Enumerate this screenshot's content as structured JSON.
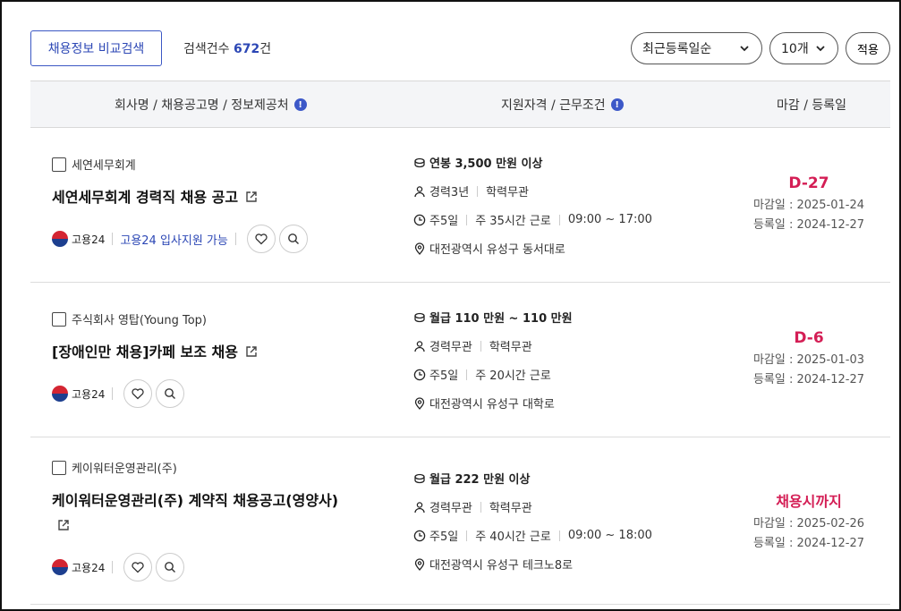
{
  "toolbar": {
    "compare_label": "채용정보 비교검색",
    "count_prefix": "검색건수 ",
    "count_value": "672",
    "count_suffix": "건",
    "sort_selected": "최근등록일순",
    "per_page_selected": "10개",
    "apply_label": "적용"
  },
  "header": {
    "col1": "회사명 / 채용공고명 / 정보제공처",
    "col2": "지원자격 / 근무조건",
    "col3": "마감 / 등록일",
    "info_glyph": "!"
  },
  "jobs": [
    {
      "company": "세연세무회계",
      "title": "세연세무회계 경력직 채용 공고",
      "source": "고용24",
      "apply_note": "고용24 입사지원 가능",
      "salary": "연봉 3,500 만원 이상",
      "career": "경력3년",
      "education": "학력무관",
      "days": "주5일",
      "hours": "주 35시간 근로",
      "time": "09:00 ~ 17:00",
      "location": "대전광역시 유성구 동서대로",
      "dday": "D-27",
      "deadline": "마감일 : 2025-01-24",
      "registered": "등록일 : 2024-12-27"
    },
    {
      "company": "주식회사 영탑(Young Top)",
      "title": "[장애인만 채용]카페 보조 채용",
      "source": "고용24",
      "salary": "월급 110 만원 ~ 110 만원",
      "career": "경력무관",
      "education": "학력무관",
      "days": "주5일",
      "hours": "주 20시간 근로",
      "location": "대전광역시 유성구 대학로",
      "dday": "D-6",
      "deadline": "마감일 : 2025-01-03",
      "registered": "등록일 : 2024-12-27"
    },
    {
      "company": "케이워터운영관리(주)",
      "title": "케이워터운영관리(주) 계약직 채용공고(영양사)",
      "source": "고용24",
      "salary": "월급 222 만원 이상",
      "career": "경력무관",
      "education": "학력무관",
      "days": "주5일",
      "hours": "주 40시간 근로",
      "time": "09:00 ~ 18:00",
      "location": "대전광역시 유성구 테크노8로",
      "dday": "채용시까지",
      "deadline": "마감일 : 2025-02-26",
      "registered": "등록일 : 2024-12-27"
    }
  ],
  "colors": {
    "accent": "#2c47b5",
    "dday": "#d41e55",
    "header_bg": "#f4f5f7"
  },
  "icons": [
    "external-link-icon",
    "heart-icon",
    "search-icon",
    "coin-icon",
    "person-icon",
    "clock-icon",
    "location-pin-icon",
    "chevron-down-icon",
    "info-icon",
    "goyong24-logo-icon"
  ]
}
